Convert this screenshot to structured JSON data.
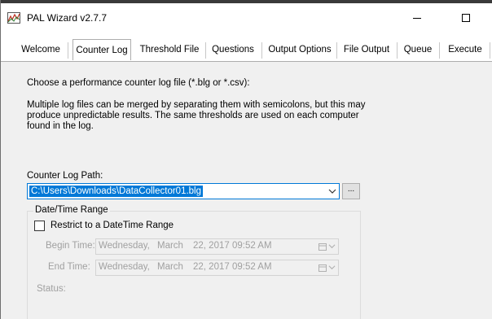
{
  "window": {
    "title": "PAL Wizard v2.7.7",
    "app_icon": "pal-chart-icon",
    "controls": [
      "minimize-icon",
      "maximize-icon"
    ]
  },
  "tabs": [
    {
      "label": "Welcome",
      "active": false
    },
    {
      "label": "Counter Log",
      "active": true
    },
    {
      "label": "Threshold File",
      "active": false
    },
    {
      "label": "Questions",
      "active": false
    },
    {
      "label": "Output Options",
      "active": false
    },
    {
      "label": "File Output",
      "active": false
    },
    {
      "label": "Queue",
      "active": false
    },
    {
      "label": "Execute",
      "active": false
    }
  ],
  "content": {
    "instruction": "Choose a performance counter log file (*.blg or *.csv):",
    "note_lines": [
      "Multiple log files can be merged by separating them with semicolons, but this may",
      "produce unpredictable results. The same thresholds are used on each computer",
      "found in the log."
    ],
    "path_label": "Counter Log Path:",
    "path_value": "C:\\Users\\Downloads\\DataCollector01.blg",
    "browse_label": "...",
    "group_title": "Date/Time Range",
    "restrict_label": "Restrict to a DateTime Range",
    "restrict_checked": false,
    "begin_label": "Begin Time:",
    "end_label": "End Time:",
    "begin": {
      "weekday": "Wednesday,",
      "month": "March",
      "rest": "22, 2017 09:52 AM"
    },
    "end": {
      "weekday": "Wednesday,",
      "month": "March",
      "rest": "22, 2017 09:52 AM"
    },
    "status_label": "Status:"
  },
  "colors": {
    "selection": "#0078d7",
    "window_bg": "#f0f0f0",
    "disabled_text": "#a0a0a0"
  }
}
